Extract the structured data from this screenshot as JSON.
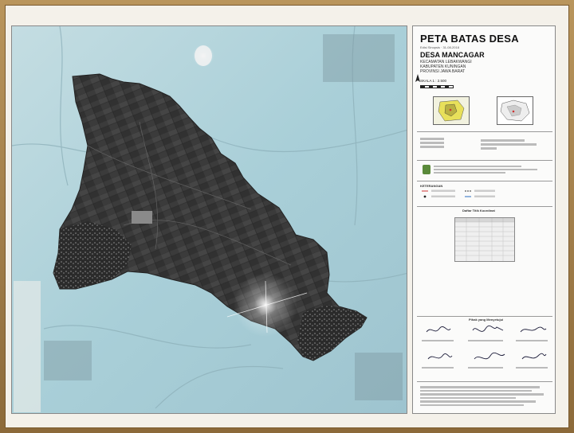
{
  "map": {
    "title": "PETA BATAS DESA",
    "subtitle": "Edisi Sinopsis · 31-08-2018",
    "village": "DESA MANCAGAR",
    "kecamatan": "KECAMATAN LEBAKWANGI",
    "kabupaten": "KABUPATEN KUNINGAN",
    "provinsi": "PROVINSI JAWA BARAT",
    "scale": "SKALA 1 : 2.500",
    "legend_heading": "KETERANGAN",
    "table_heading": "Daftar Titik Koordinat",
    "signatures_heading": "Pihak yang Menyetujui",
    "colors": {
      "village_area": "#3a3a3a",
      "surroundings": "#a9cfd8",
      "frame": "#a17f4b"
    }
  }
}
